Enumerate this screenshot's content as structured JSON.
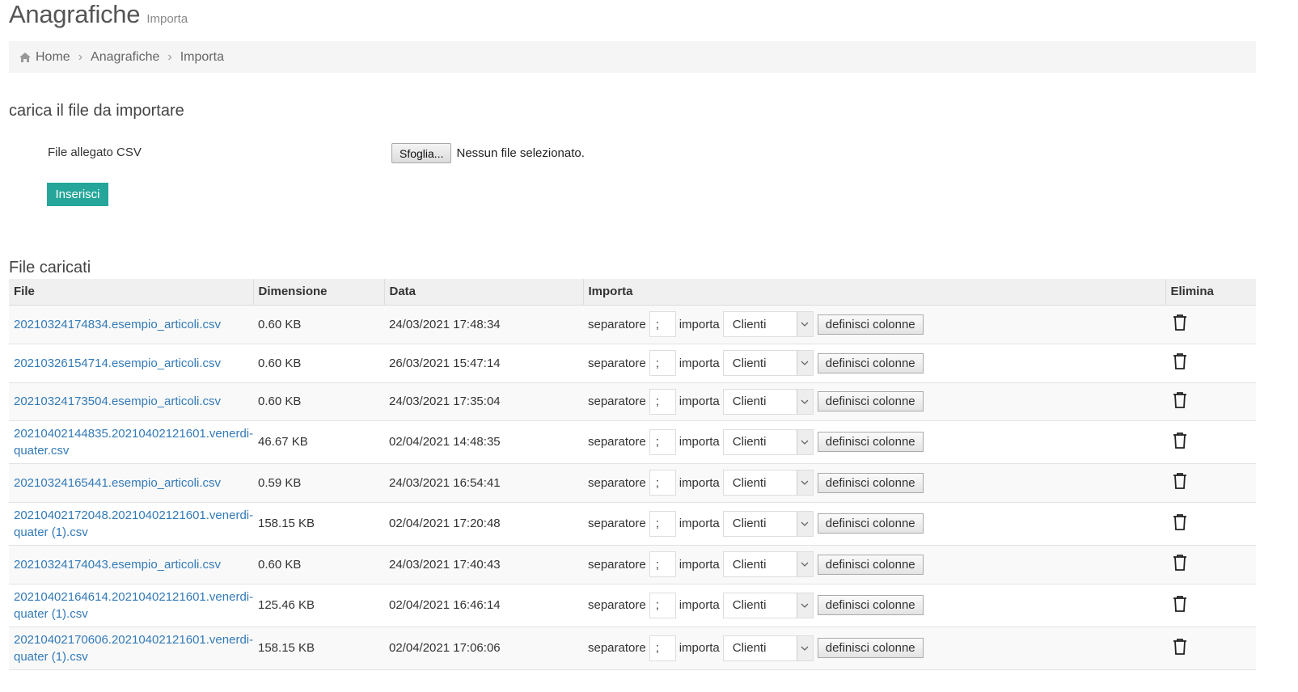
{
  "header": {
    "title": "Anagrafiche",
    "subtitle": "Importa"
  },
  "breadcrumb": {
    "home": "Home",
    "section": "Anagrafiche",
    "current": "Importa"
  },
  "upload": {
    "section_title": "carica il file da importare",
    "field_label": "File allegato CSV",
    "browse_label": "Sfoglia...",
    "no_file_text": "Nessun file selezionato.",
    "submit_label": "Inserisci"
  },
  "files": {
    "title": "File caricati",
    "columns": {
      "file": "File",
      "size": "Dimensione",
      "date": "Data",
      "import": "Importa",
      "delete": "Elimina"
    },
    "row_labels": {
      "separator": "separatore",
      "import": "importa",
      "define": "definisci colonne"
    },
    "rows": [
      {
        "name": "20210324174834.esempio_articoli.csv",
        "size": "0.60 KB",
        "date": "24/03/2021 17:48:34",
        "separator": ";",
        "target": "Clienti"
      },
      {
        "name": "20210326154714.esempio_articoli.csv",
        "size": "0.60 KB",
        "date": "26/03/2021 15:47:14",
        "separator": ";",
        "target": "Clienti"
      },
      {
        "name": "20210324173504.esempio_articoli.csv",
        "size": "0.60 KB",
        "date": "24/03/2021 17:35:04",
        "separator": ";",
        "target": "Clienti"
      },
      {
        "name": "20210402144835.20210402121601.venerdi-quater.csv",
        "size": "46.67 KB",
        "date": "02/04/2021 14:48:35",
        "separator": ";",
        "target": "Clienti"
      },
      {
        "name": "20210324165441.esempio_articoli.csv",
        "size": "0.59 KB",
        "date": "24/03/2021 16:54:41",
        "separator": ";",
        "target": "Clienti"
      },
      {
        "name": "20210402172048.20210402121601.venerdi-quater (1).csv",
        "size": "158.15 KB",
        "date": "02/04/2021 17:20:48",
        "separator": ";",
        "target": "Clienti"
      },
      {
        "name": "20210324174043.esempio_articoli.csv",
        "size": "0.60 KB",
        "date": "24/03/2021 17:40:43",
        "separator": ";",
        "target": "Clienti"
      },
      {
        "name": "20210402164614.20210402121601.venerdi-quater (1).csv",
        "size": "125.46 KB",
        "date": "02/04/2021 16:46:14",
        "separator": ";",
        "target": "Clienti"
      },
      {
        "name": "20210402170606.20210402121601.venerdi-quater (1).csv",
        "size": "158.15 KB",
        "date": "02/04/2021 17:06:06",
        "separator": ";",
        "target": "Clienti"
      }
    ]
  },
  "colors": {
    "accent": "#26a69a",
    "link": "#337ab7"
  },
  "icons": {
    "home": "home-icon",
    "delete": "trash-icon",
    "dropdown": "chevron-down-icon"
  }
}
